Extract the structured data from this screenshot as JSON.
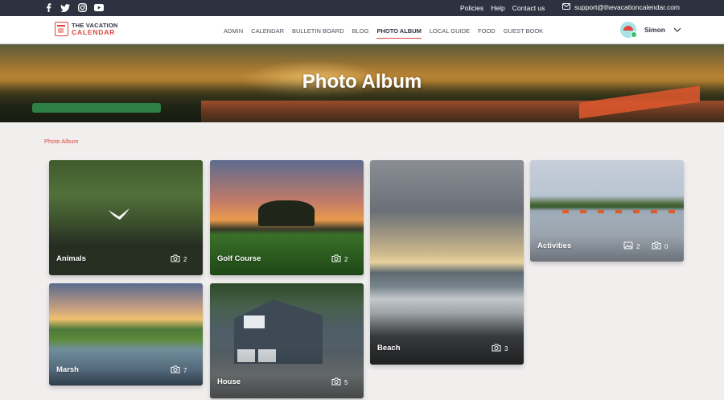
{
  "topbar": {
    "social": [
      "facebook-icon",
      "twitter-icon",
      "instagram-icon",
      "youtube-icon"
    ],
    "links": [
      "Policies",
      "Help",
      "Contact us"
    ],
    "support_email": "support@thevacationcalendar.com"
  },
  "nav": {
    "logo_line1": "THE VACATION",
    "logo_line2": "CALENDAR",
    "menu": [
      "ADMIN",
      "CALENDAR",
      "BULLETIN BOARD",
      "BLOG",
      "PHOTO ALBUM",
      "LOCAL GUIDE",
      "FOOD",
      "GUEST BOOK"
    ],
    "active": "PHOTO ALBUM",
    "user_name": "Simon"
  },
  "hero": {
    "title": "Photo Album"
  },
  "breadcrumb": "Photo Album",
  "albums": {
    "animals": {
      "label": "Animals",
      "photos": "2"
    },
    "golf": {
      "label": "Golf Course",
      "photos": "2"
    },
    "beach": {
      "label": "Beach",
      "photos": "3"
    },
    "activities": {
      "label": "Activities",
      "images": "2",
      "photos": "0"
    },
    "marsh": {
      "label": "Marsh",
      "photos": "7"
    },
    "house": {
      "label": "House",
      "photos": "5"
    }
  },
  "colors": {
    "accent": "#e0463f",
    "topbar": "#2c3240",
    "background": "#f1eeee"
  }
}
